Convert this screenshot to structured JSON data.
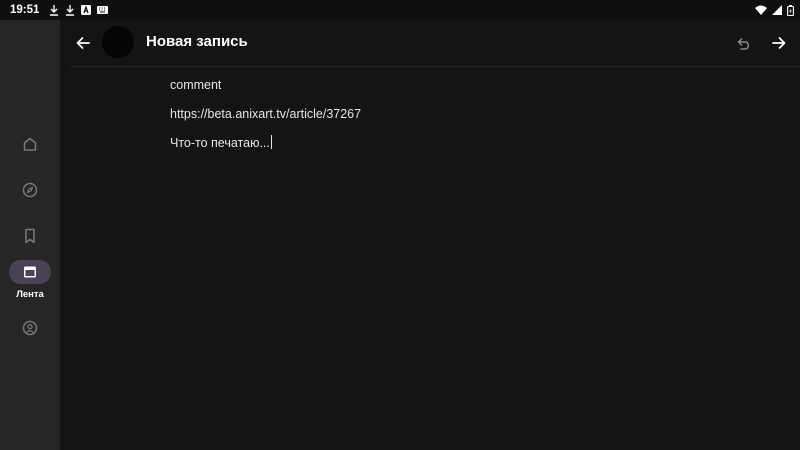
{
  "status_bar": {
    "time": "19:51",
    "notification_icons": [
      "download-icon",
      "download-icon",
      "anixart-icon",
      "keyboard-icon"
    ],
    "system_icons": [
      "wifi-icon",
      "signal-icon",
      "battery-icon"
    ]
  },
  "rail": {
    "items": [
      {
        "icon": "home-icon",
        "label": ""
      },
      {
        "icon": "compass-icon",
        "label": ""
      },
      {
        "icon": "bookmark-icon",
        "label": ""
      },
      {
        "icon": "feed-icon",
        "label": "Лента",
        "active": true
      },
      {
        "icon": "profile-icon",
        "label": ""
      }
    ]
  },
  "header": {
    "title": "Новая запись"
  },
  "editor": {
    "lines": [
      "comment",
      "https://beta.anixart.tv/article/37267",
      "Что-то печатаю..."
    ]
  },
  "colors": {
    "background": "#141414",
    "rail": "#262626",
    "active_indicator": "#4a4358",
    "text": "#e6e6e6"
  }
}
